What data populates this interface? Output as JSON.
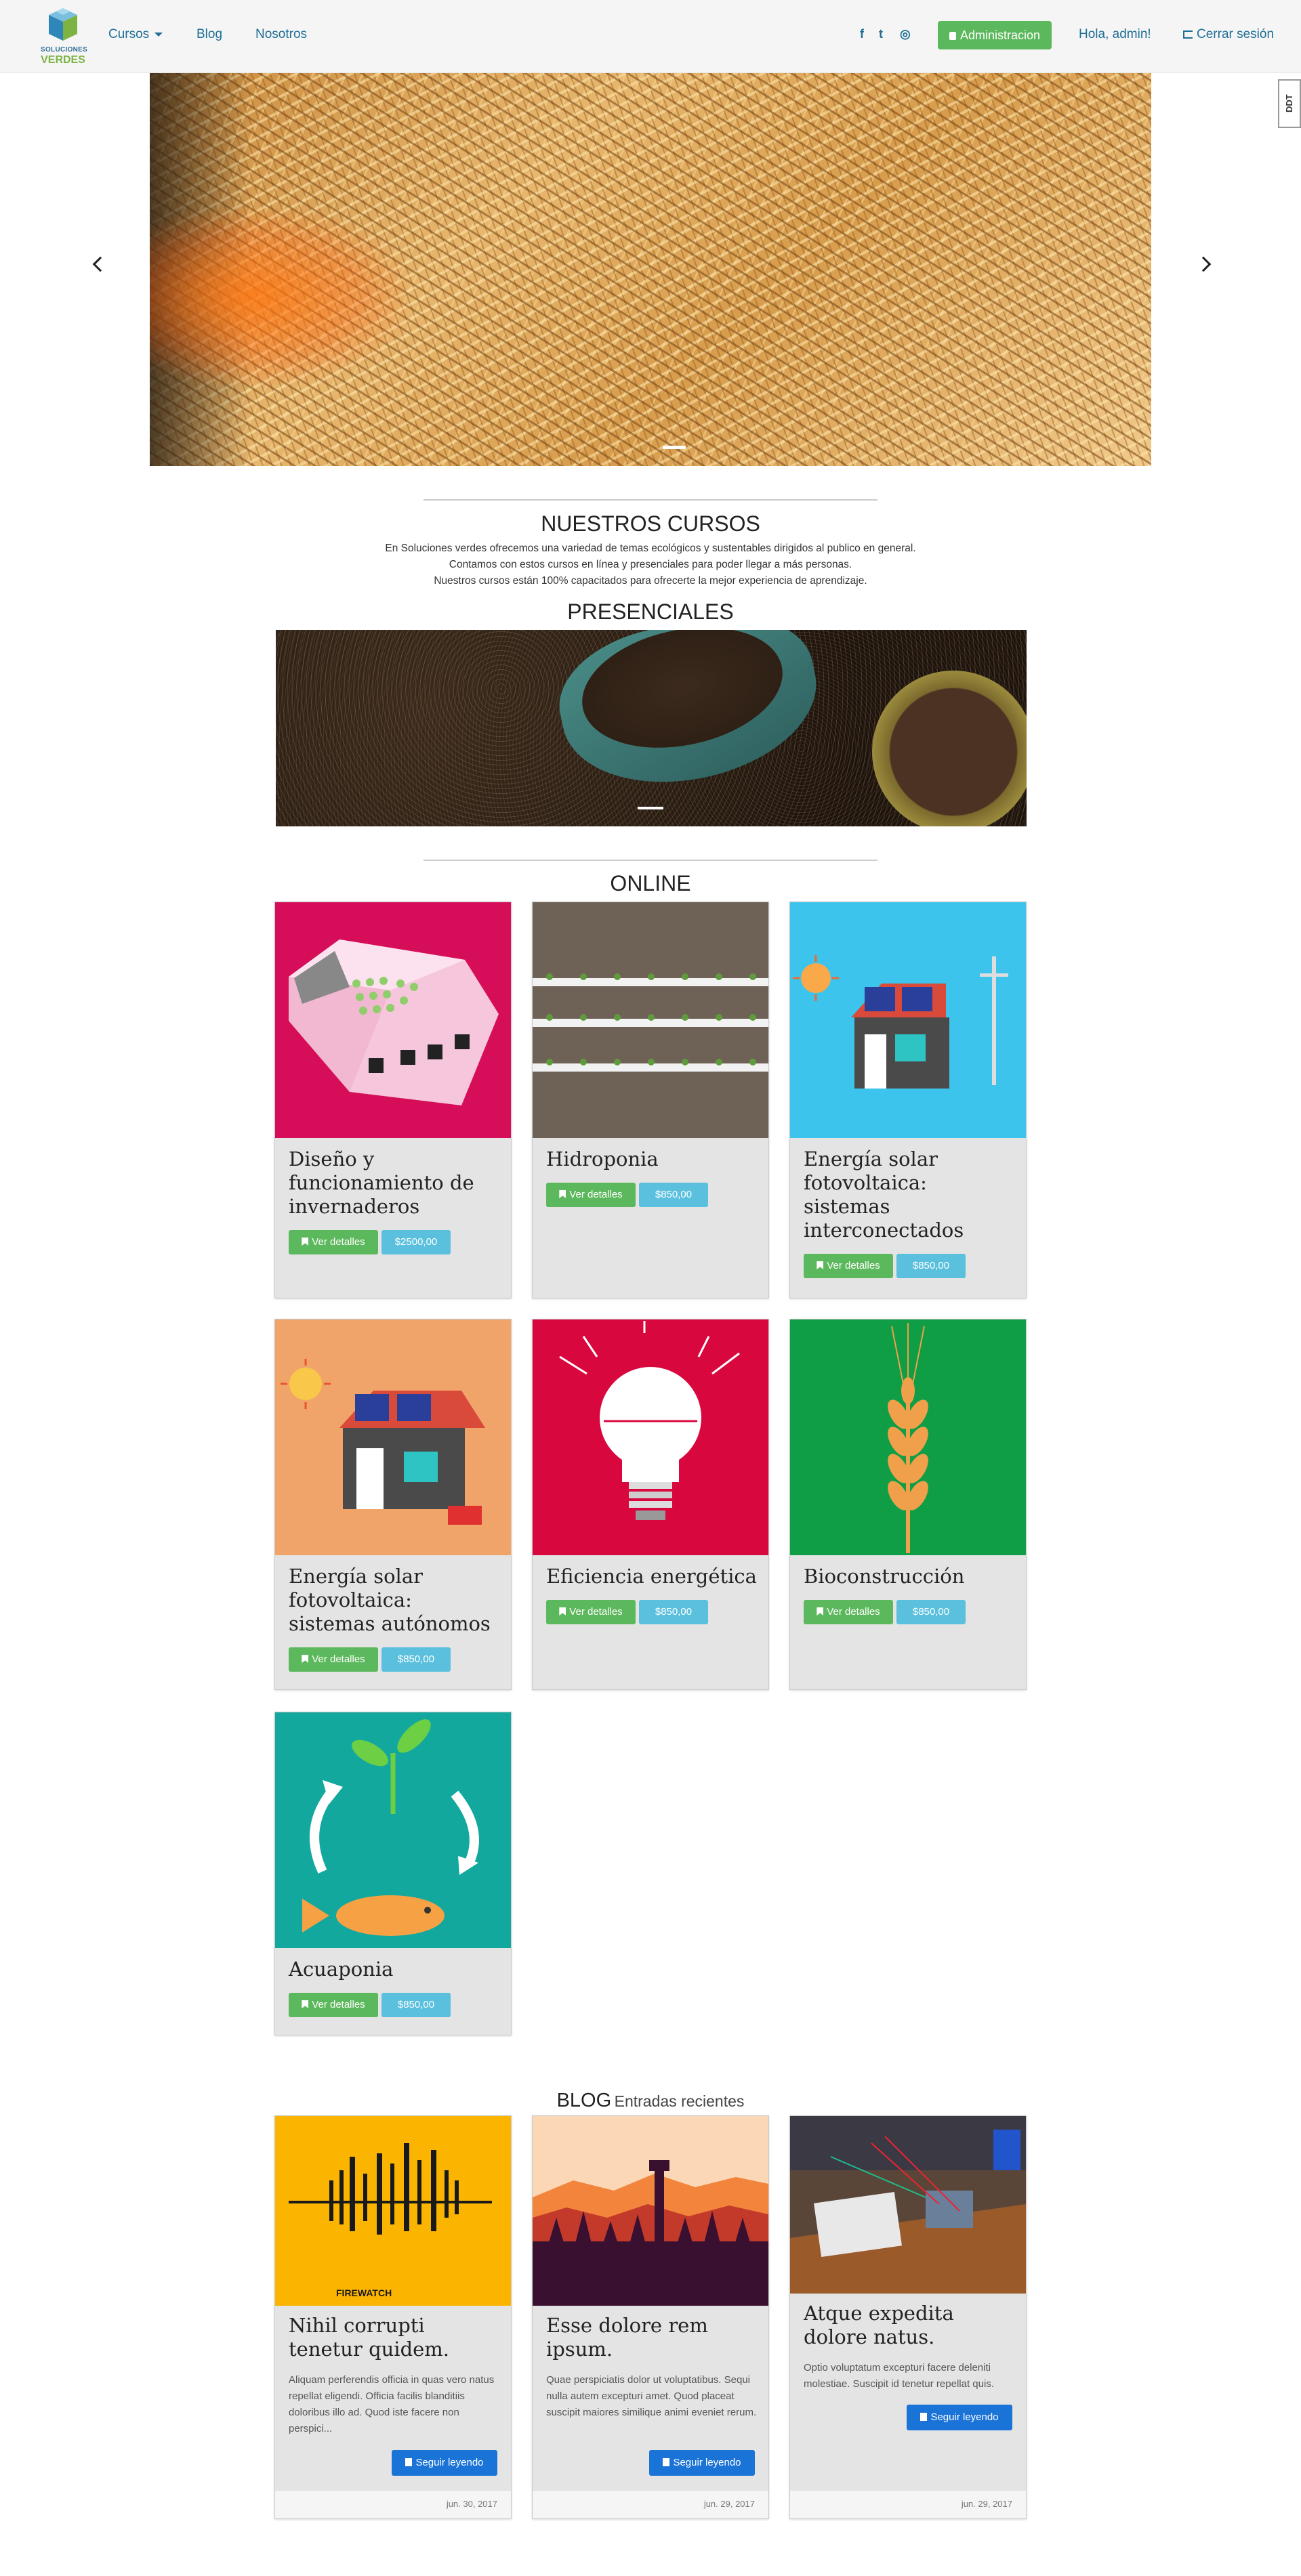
{
  "brand": {
    "line1": "SOLUCIONES",
    "line2": "VERDES"
  },
  "nav": {
    "cursos": "Cursos",
    "blog": "Blog",
    "nosotros": "Nosotros",
    "social": {
      "facebook": "f",
      "twitter": "t",
      "instagram": "◎"
    },
    "admin": "Administracion",
    "greeting": "Hola, admin!",
    "logout": "Cerrar sesión"
  },
  "ddt": "DDT",
  "courses_section": {
    "title": "NUESTROS CURSOS",
    "intro": [
      "En Soluciones verdes ofrecemos una variedad de temas ecológicos y sustentables dirigidos al publico en general.",
      "Contamos con estos cursos en línea y presenciales para poder llegar a más personas.",
      "Nuestros cursos están 100% capacitados para ofrecerte la mejor experiencia de aprendizaje."
    ],
    "presenciales": "PRESENCIALES",
    "online": "ONLINE"
  },
  "details_label": "Ver detalles",
  "courses": [
    {
      "title": "Diseño y funcionamiento de invernaderos",
      "price": "$2500,00"
    },
    {
      "title": "Hidroponia",
      "price": "$850,00"
    },
    {
      "title": "Energía solar fotovoltaica: sistemas interconectados",
      "price": "$850,00"
    },
    {
      "title": "Energía solar fotovoltaica: sistemas autónomos",
      "price": "$850,00"
    },
    {
      "title": "Eficiencia energética",
      "price": "$850,00"
    },
    {
      "title": "Bioconstrucción",
      "price": "$850,00"
    },
    {
      "title": "Acuaponia",
      "price": "$850,00"
    }
  ],
  "colors": {
    "accent": "#1f6f96",
    "green": "#5cb85c",
    "info": "#5bc0de",
    "primary": "#1a73d6"
  },
  "blog": {
    "title": "BLOG",
    "subtitle": "Entradas recientes",
    "read_more": "Seguir leyendo",
    "poster_text": "FIREWATCH",
    "posts": [
      {
        "title": "Nihil corrupti tenetur quidem.",
        "excerpt": "Aliquam perferendis officia in quas vero natus repellat eligendi. Officia facilis blanditiis doloribus illo ad. Quod iste facere non perspici...",
        "date": "jun. 30, 2017"
      },
      {
        "title": "Esse dolore rem ipsum.",
        "excerpt": "Quae perspiciatis dolor ut voluptatibus. Sequi nulla autem excepturi amet. Quod placeat suscipit maiores similique animi eveniet rerum.",
        "date": "jun. 29, 2017"
      },
      {
        "title": "Atque expedita dolore natus.",
        "excerpt": "Optio voluptatum excepturi facere deleniti molestiae. Suscipit id tenetur repellat quis.",
        "date": "jun. 29, 2017"
      }
    ]
  }
}
